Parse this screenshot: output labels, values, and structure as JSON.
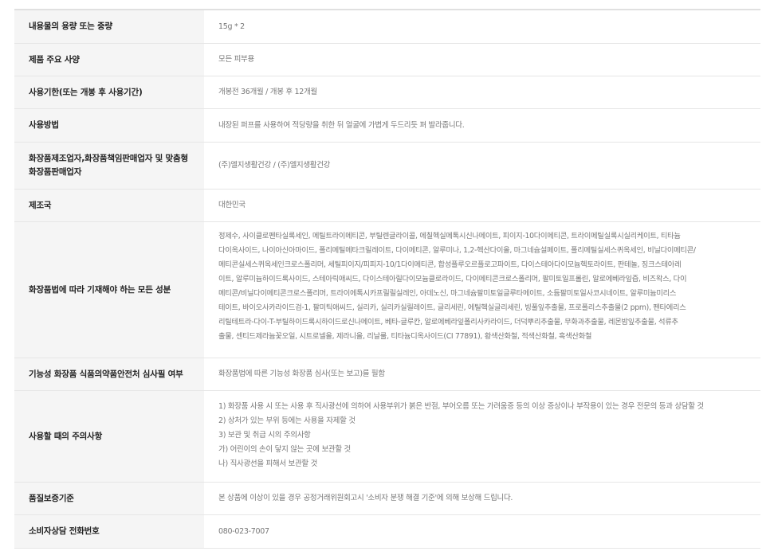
{
  "rows": [
    {
      "label": "내용물의 용량 또는 중량",
      "value": "15g * 2"
    },
    {
      "label": "제품 주요 사양",
      "value": "모든 피부용"
    },
    {
      "label": "사용기한(또는 개봉 후 사용기간)",
      "value": "개봉전 36개월 / 개봉 후 12개월"
    },
    {
      "label": "사용방법",
      "value": "내장된 퍼프를 사용하여 적당량을 취한 뒤 얼굴에 가볍게 두드리듯 펴 발라줍니다."
    },
    {
      "label_lines": [
        "화장품제조업자,화장품책임판매업자 및 맞춤형",
        "화장품판매업자"
      ],
      "value": "(주)엘지생활건강 / (주)엘지생활건강"
    },
    {
      "label": "제조국",
      "value": "대한민국"
    },
    {
      "label": "화장품법에 따라 기재해야 하는 모든 성분",
      "value_lines": [
        "정제수, 사이클로펜타실록세인, 메틸트라이메티콘, 부틸렌글라이콜, 에칠헥실메톡시신나메이트, 피이지-10다이메티콘, 트라이메틸실록시실리케이트, 티타늄",
        "다이옥사이드, 나이아신아마이드, 폴리메틸메타크릴레이트, 다이메티콘, 알루미나, 1,2-헥산다이올, 마그네슘설페이트, 폴리메틸실세스퀴옥세인, 비닐다이메티콘/",
        "메티콘실세스퀴옥세인크로스폴리머, 세틸피이지/피피지-10/1다이메티콘, 합성플루오르플로고파이트, 다이스테아다이모늄헥토라이트, 판테놀, 징크스테아레",
        "이트, 알루미늄하이드록사이드, 스테아릭애씨드, 다이스테아릴다이모늄클로라이드, 다이메티콘크로스폴리머, 팔미토일프롤린, 알로에베라잎즙, 비즈왁스, 다이",
        "메티콘/비닐다이메티콘크로스폴리머, 트라이에톡시카프릴릴실레인, 아데노신, 마그네슘팔미토일글루타메이트, 소듐팔미토일사코시네이트, 알루미늄미리스",
        "테이트, 바이오사카라이드검-1, 팔미틱애씨드, 실리카, 실리카실릴레이트, 글리세린, 에틸헥실글리세린, 빙풀잎추출물, 프로폴리스추출물(2 ppm), 펜타에리스",
        "리틸테트라-다이-T-부틸하이드록시하이드로신나메이트, 베타-글루칸, 알로에베라잎폴리사카라이드, 더덕뿌리추출물, 무화과추출물, 레몬밤잎추출물, 석류추",
        "출물, 센티드제라늄꽃오일, 시트로넬올, 제라니올, 리날룰, 티타늄디옥사이드(CI 77891), 황색산화철, 적색산화철, 흑색산화철"
      ]
    },
    {
      "label": "기능성 화장품 식품의약품안전처 심사필 여부",
      "value": "화장품법에 따른 기능성 화장품 심사(또는 보고)를 필함"
    },
    {
      "label": "사용할 때의 주의사항",
      "value_lines": [
        "1) 화장품 사용 시 또는 사용 후 직사광선에 의하여 사용부위가 붉은 반점, 부어오름 또는 가려움증 등의 이상 증상이나 부작용이 있는 경우 전문의 등과 상담할 것",
        "2) 상처가 있는 부위 등에는 사용을 자제할 것",
        "3) 보관 및 취급 시의 주의사항",
        "가) 어린이의 손이 닿지 않는 곳에 보관할 것",
        "나) 직사광선을 피해서 보관할 것"
      ]
    },
    {
      "label": "품질보증기준",
      "value": "본 상품에 이상이 있을 경우 공정거래위원회고시 '소비자 분쟁 해결 기준'에 의해 보상해 드립니다."
    },
    {
      "label": "소비자상담 전화번호",
      "value": "080-023-7007"
    }
  ]
}
